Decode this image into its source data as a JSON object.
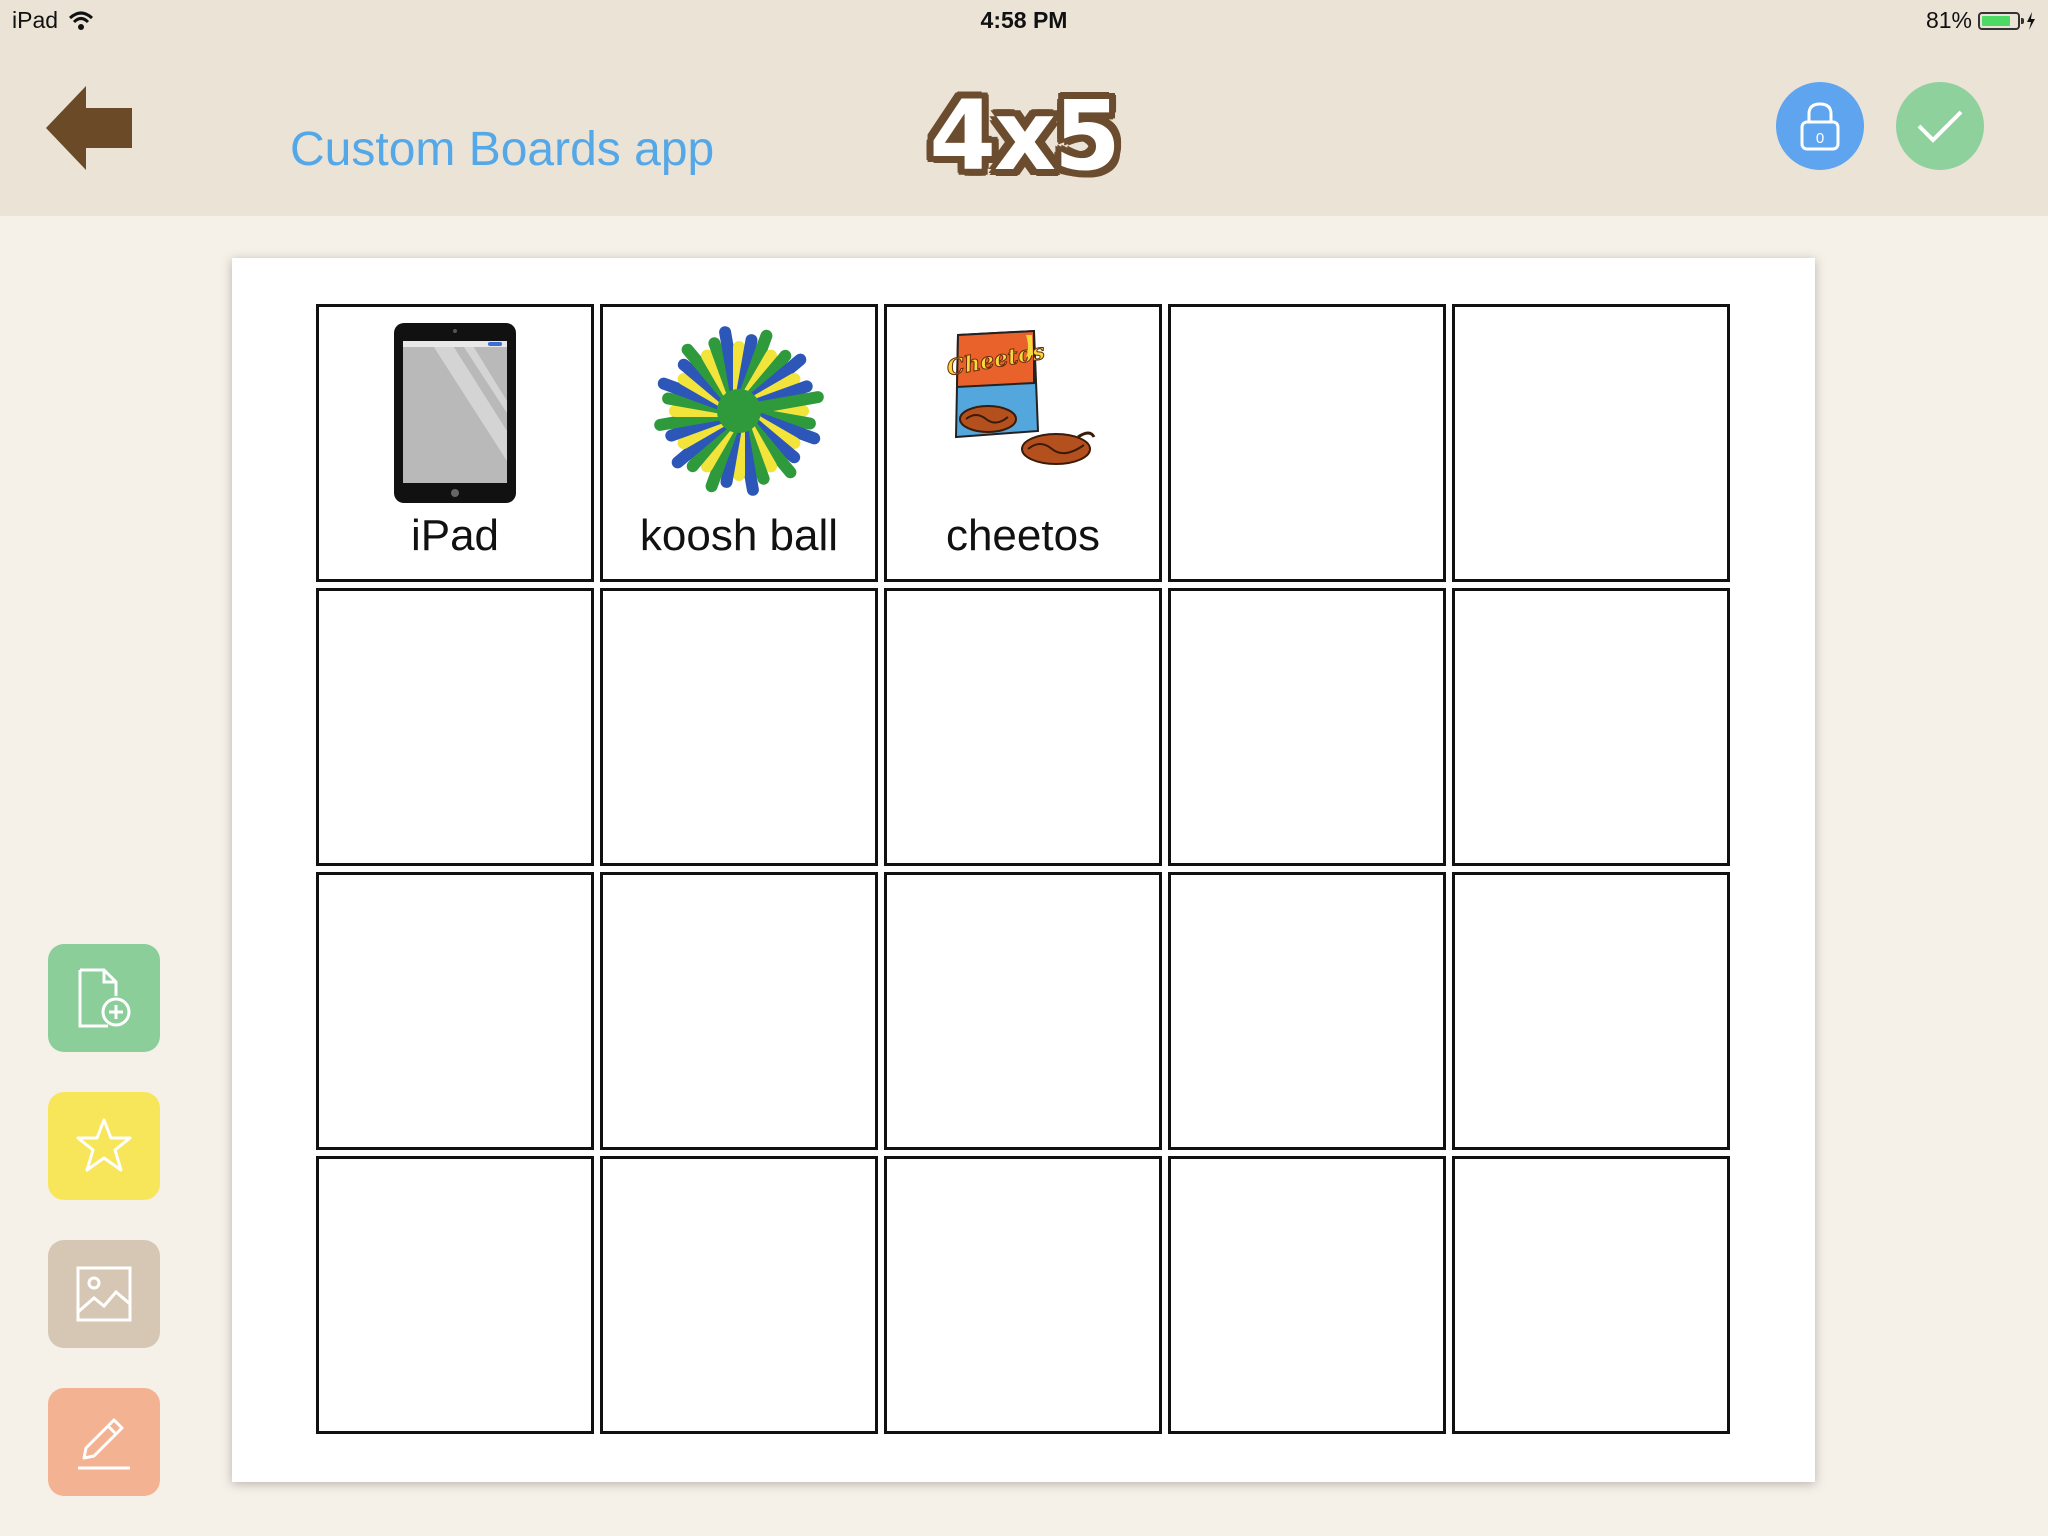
{
  "status_bar": {
    "device": "iPad",
    "time": "4:58 PM",
    "battery": "81%",
    "battery_level": 0.81
  },
  "header": {
    "app_name": "Custom Boards app",
    "board_title": "4x5",
    "lock_counter": "0"
  },
  "board": {
    "rows": 4,
    "columns": 5,
    "cells": [
      {
        "label": "iPad",
        "icon": "ipad-picture"
      },
      {
        "label": "koosh ball",
        "icon": "koosh-ball-picture"
      },
      {
        "label": "cheetos",
        "icon": "cheetos-picture",
        "brand_text": "Cheetos"
      }
    ]
  },
  "toolbar": {
    "tools": [
      "add-page",
      "favorite",
      "image",
      "edit"
    ]
  },
  "colors": {
    "header_bg": "#ebe3d6",
    "page_bg": "#f5f0e8",
    "app_name": "#55a8e8",
    "title_outline": "#6b4c2e",
    "lock_button": "#5fa4ef",
    "done_button": "#8fd19c",
    "tool_add": "#8bce99",
    "tool_fav": "#f7e65a",
    "tool_img": "#d6c7b5",
    "tool_edit": "#f3b291"
  }
}
